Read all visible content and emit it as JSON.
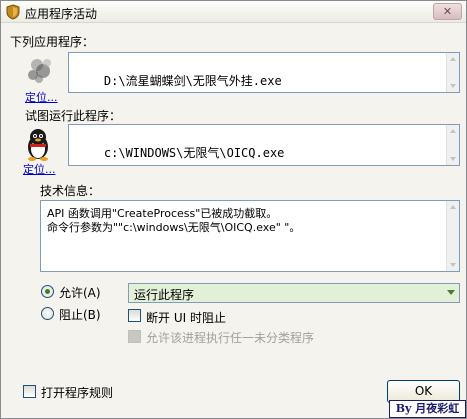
{
  "window": {
    "title": "应用程序活动",
    "close_label": "✕"
  },
  "section_program": {
    "label": "下列应用程序：",
    "path": "D:\\流星蝴蝶剑\\无限气外挂.exe",
    "locate_link": "定位..."
  },
  "section_target": {
    "label": "试图运行此程序：",
    "path": "c:\\WINDOWS\\无限气\\OICQ.exe",
    "locate_link": "定位..."
  },
  "tech_info": {
    "label": "技术信息：",
    "lines": [
      "API 函数调用\"CreateProcess\"已被成功截取。",
      "命令行参数为\"\"c:\\windows\\无限气\\OICQ.exe\" \"。"
    ]
  },
  "options": {
    "allow_label": "允许(A)",
    "allow_checked": true,
    "block_label": "阻止(B)",
    "block_checked": false,
    "action_select": "运行此程序",
    "ui_block_label": "断开 UI 时阻止",
    "ui_block_checked": false,
    "allow_unclassified_label": "允许该进程执行任一未分类程序",
    "allow_unclassified_disabled": true
  },
  "footer": {
    "open_rules_label": "打开程序规则",
    "open_rules_checked": false,
    "ok_label": "OK"
  },
  "watermark": "By 月夜彩虹",
  "colors": {
    "window_bg": "#f4f3ee",
    "textbox_border": "#7f9db9",
    "select_bg": "#e3f0d8",
    "link": "#0000cc"
  },
  "icons": {
    "app": "shield-icon",
    "program": "blurred-exe-icon",
    "target": "qq-penguin-icon"
  }
}
